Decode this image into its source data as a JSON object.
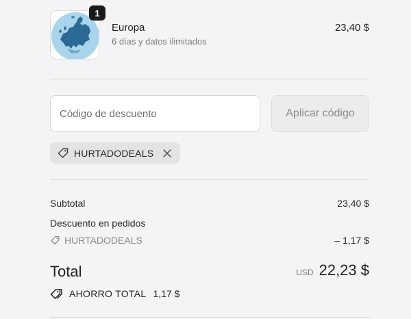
{
  "product": {
    "name": "Europa",
    "description": "6 días y datos ilimitados",
    "price": "23,40 $",
    "quantity": "1",
    "image_icon": "europe-globe-icon"
  },
  "discount": {
    "placeholder": "Código de descuento",
    "value": "",
    "apply_label": "Aplicar código",
    "applied_code": "HURTADODEALS",
    "tag_icon": "tag-icon",
    "remove_icon": "close-icon"
  },
  "summary": {
    "subtotal_label": "Subtotal",
    "subtotal_value": "23,40 $",
    "order_discount_label": "Descuento en pedidos",
    "order_discount_code": "HURTADODEALS",
    "order_discount_value": "– 1,17 $",
    "total_label": "Total",
    "currency": "USD",
    "total_value": "22,23 $",
    "savings_label": "AHORRO TOTAL",
    "savings_value": "1,17 $"
  },
  "colors": {
    "background": "#f4f4f6",
    "text": "#1f1f1f",
    "muted": "#8a8a8d",
    "badge": "#1a1a1a",
    "map_land": "#2a6a95",
    "map_sea": "#a9d5ec"
  }
}
